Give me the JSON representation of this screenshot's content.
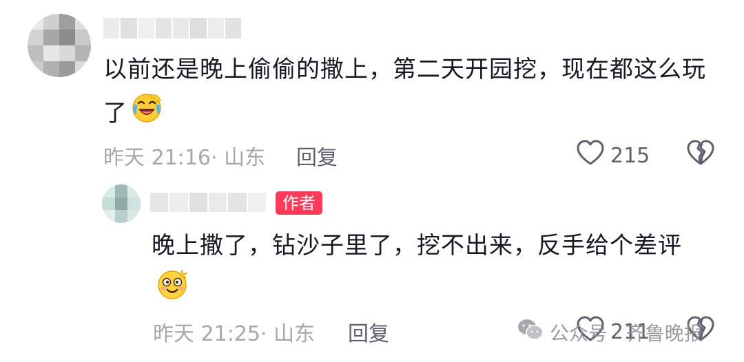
{
  "comments": [
    {
      "text": "以前还是晚上偷偷的撒上，第二天开园挖，现在都这么玩了",
      "emoji": "laughing-crying-emoji",
      "time": "昨天 21:16",
      "location": "· 山东",
      "reply_label": "回复",
      "likes": "215"
    },
    {
      "badge": "作者",
      "text": "晚上撒了，钻沙子里了，挖不出来，反手给个差评",
      "emoji": "dizzy-smile-emoji",
      "time": "昨天 21:25",
      "location": "· 山东",
      "reply_label": "回复",
      "likes": "211"
    }
  ],
  "watermark": {
    "text": "公众号 · 齐鲁晚报",
    "icon": "wechat-icon"
  },
  "colors": {
    "text": "#161823",
    "meta": "#a6a6ad",
    "action": "#5e6070",
    "badge": "#fd3a57"
  }
}
